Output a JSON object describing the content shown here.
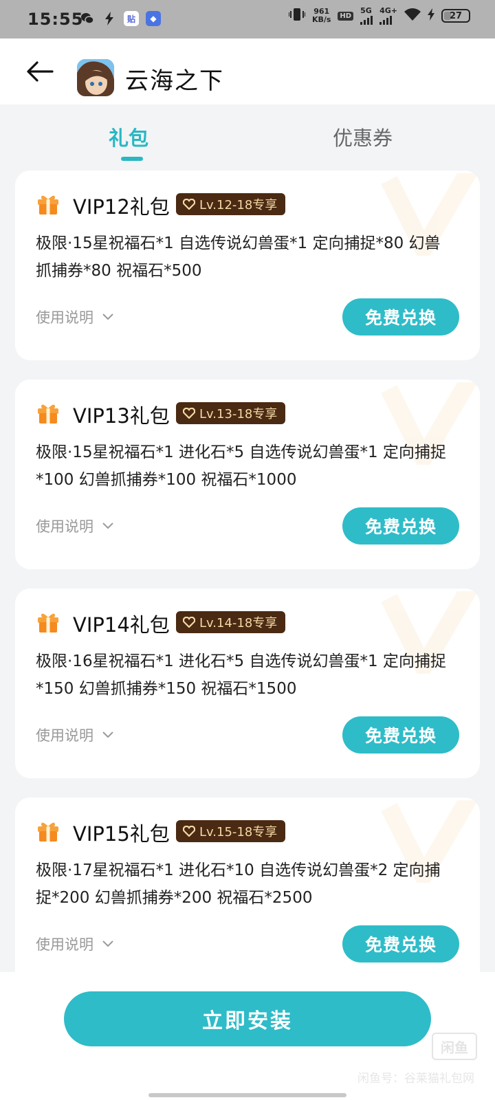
{
  "status_bar": {
    "time": "15:55",
    "net_speed_value": "961",
    "net_speed_unit": "KB/s",
    "sim1_label": "5G",
    "sim2_label": "4G+",
    "battery_level": "27",
    "icons": [
      "wechat-icon",
      "lightning-icon",
      "app-badge-icon",
      "app-badge-icon",
      "vibrate-icon",
      "hd-icon",
      "signal-icon",
      "wifi-icon",
      "charging-icon",
      "battery-icon"
    ]
  },
  "header": {
    "title": "云海之下"
  },
  "tabs": [
    {
      "label": "礼包",
      "active": true
    },
    {
      "label": "优惠券",
      "active": false
    }
  ],
  "cards": [
    {
      "title": "VIP12礼包",
      "level": "Lv.12-18专享",
      "desc": "极限·15星祝福石*1 自选传说幻兽蛋*1 定向捕捉*80 幻兽抓捕券*80 祝福石*500",
      "usage_label": "使用说明",
      "button_label": "免费兑换"
    },
    {
      "title": "VIP13礼包",
      "level": "Lv.13-18专享",
      "desc": "极限·15星祝福石*1 进化石*5 自选传说幻兽蛋*1 定向捕捉*100 幻兽抓捕券*100 祝福石*1000",
      "usage_label": "使用说明",
      "button_label": "免费兑换"
    },
    {
      "title": "VIP14礼包",
      "level": "Lv.14-18专享",
      "desc": "极限·16星祝福石*1 进化石*5 自选传说幻兽蛋*1 定向捕捉*150 幻兽抓捕券*150 祝福石*1500",
      "usage_label": "使用说明",
      "button_label": "免费兑换"
    },
    {
      "title": "VIP15礼包",
      "level": "Lv.15-18专享",
      "desc": "极限·17星祝福石*1 进化石*10 自选传说幻兽蛋*2 定向捕捉*200 幻兽抓捕券*200 祝福石*2500",
      "usage_label": "使用说明",
      "button_label": "免费兑换"
    }
  ],
  "bottom": {
    "install_label": "立即安装",
    "watermark_logo": "闲鱼",
    "watermark_text": "闲鱼号：谷莱猫礼包网"
  },
  "colors": {
    "accent": "#2ebcc8",
    "badge_bg": "#4a2a12",
    "badge_text": "#f3d9a6"
  }
}
